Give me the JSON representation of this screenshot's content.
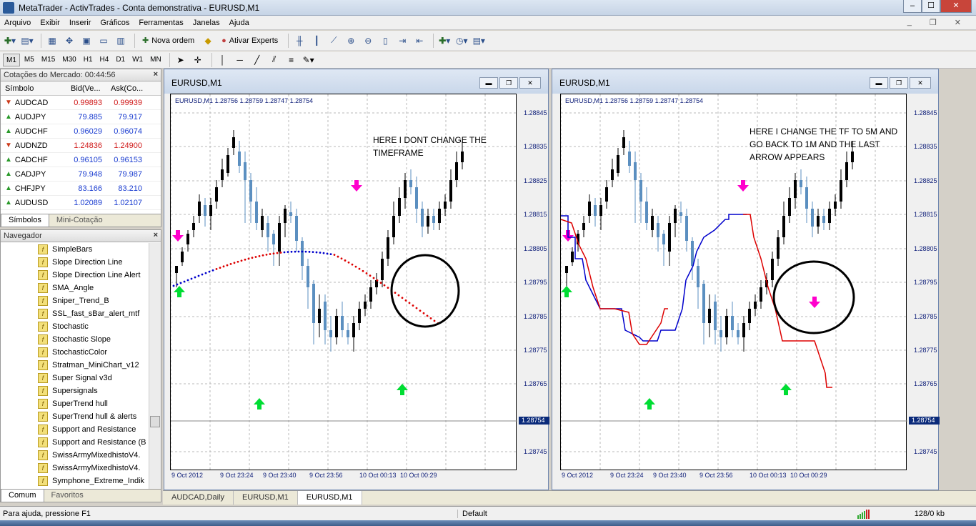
{
  "window": {
    "title": "MetaTrader - ActivTrades - Conta demonstrativa - EURUSD,M1"
  },
  "menu": [
    "Arquivo",
    "Exibir",
    "Inserir",
    "Gráficos",
    "Ferramentas",
    "Janelas",
    "Ajuda"
  ],
  "toolbar": {
    "new_order": "Nova ordem",
    "experts": "Ativar Experts"
  },
  "timeframes": [
    "M1",
    "M5",
    "M15",
    "M30",
    "H1",
    "H4",
    "D1",
    "W1",
    "MN"
  ],
  "active_timeframe": "M1",
  "market_watch": {
    "title": "Cotações do Mercado: 00:44:56",
    "cols": [
      "Símbolo",
      "Bid(Ve...",
      "Ask(Co..."
    ],
    "rows": [
      {
        "sym": "AUDCAD",
        "bid": "0.99893",
        "ask": "0.99939",
        "dir": "down"
      },
      {
        "sym": "AUDJPY",
        "bid": "79.885",
        "ask": "79.917",
        "dir": "up"
      },
      {
        "sym": "AUDCHF",
        "bid": "0.96029",
        "ask": "0.96074",
        "dir": "up"
      },
      {
        "sym": "AUDNZD",
        "bid": "1.24836",
        "ask": "1.24900",
        "dir": "down"
      },
      {
        "sym": "CADCHF",
        "bid": "0.96105",
        "ask": "0.96153",
        "dir": "up"
      },
      {
        "sym": "CADJPY",
        "bid": "79.948",
        "ask": "79.987",
        "dir": "up"
      },
      {
        "sym": "CHFJPY",
        "bid": "83.166",
        "ask": "83.210",
        "dir": "up"
      },
      {
        "sym": "AUDUSD",
        "bid": "1.02089",
        "ask": "1.02107",
        "dir": "up"
      }
    ],
    "tabs": [
      "Símbolos",
      "Mini-Cotação"
    ]
  },
  "navigator": {
    "title": "Navegador",
    "items": [
      "SimpleBars",
      "Slope Direction Line",
      "Slope Direction Line Alert",
      "SMA_Angle",
      "Sniper_Trend_B",
      "SSL_fast_sBar_alert_mtf",
      "Stochastic",
      "Stochastic Slope",
      "StochasticColor",
      "Stratman_MiniChart_v12",
      "Super Signal v3d",
      "Supersignals",
      "SuperTrend hull",
      "SuperTrend hull & alerts",
      "Support and Resistance",
      "Support and Resistance (B",
      "SwissArmyMixedhistoV4.",
      "SwissArmyMixedhistoV4.",
      "Symphone_Extreme_Indik"
    ],
    "tabs": [
      "Comum",
      "Favoritos"
    ]
  },
  "charts": [
    {
      "title": "EURUSD,M1",
      "info": "EURUSD,M1  1.28756 1.28759 1.28747 1.28754",
      "annotation_lines": [
        "HERE I DONT CHANGE THE",
        "TIMEFRAME"
      ],
      "price_labels": [
        "1.28845",
        "1.28835",
        "1.28825",
        "1.28815",
        "1.28805",
        "1.28795",
        "1.28785",
        "1.28775",
        "1.28765",
        "1.28745"
      ],
      "current_price": "1.28754",
      "time_labels": [
        "9 Oct 2012",
        "9 Oct 23:24",
        "9 Oct 23:40",
        "9 Oct 23:56",
        "10 Oct 00:13",
        "10 Oct 00:29"
      ]
    },
    {
      "title": "EURUSD,M1",
      "info": "EURUSD,M1  1.28756 1.28759 1.28747 1.28754",
      "annotation_lines": [
        "HERE I CHANGE THE TF TO 5M AND",
        "GO BACK TO 1M AND THE LAST",
        "ARROW APPEARS"
      ],
      "price_labels": [
        "1.28845",
        "1.28835",
        "1.28825",
        "1.28815",
        "1.28805",
        "1.28795",
        "1.28785",
        "1.28775",
        "1.28765",
        "1.28745"
      ],
      "current_price": "1.28754",
      "time_labels": [
        "9 Oct 2012",
        "9 Oct 23:24",
        "9 Oct 23:40",
        "9 Oct 23:56",
        "10 Oct 00:13",
        "10 Oct 00:29"
      ]
    }
  ],
  "chart_tabs": [
    "AUDCAD,Daily",
    "EURUSD,M1",
    "EURUSD,M1"
  ],
  "active_chart_tab": 2,
  "status": {
    "help": "Para ajuda, pressione F1",
    "profile": "Default",
    "traffic": "128/0 kb"
  },
  "colors": {
    "bull": "#5b8fc0",
    "bear": "#000000",
    "up_arrow": "#00dd33",
    "down_arrow": "#ff00cc",
    "red_line": "#dd0000",
    "blue_line": "#0000cc",
    "current_price_bg": "#0a2a7a"
  }
}
